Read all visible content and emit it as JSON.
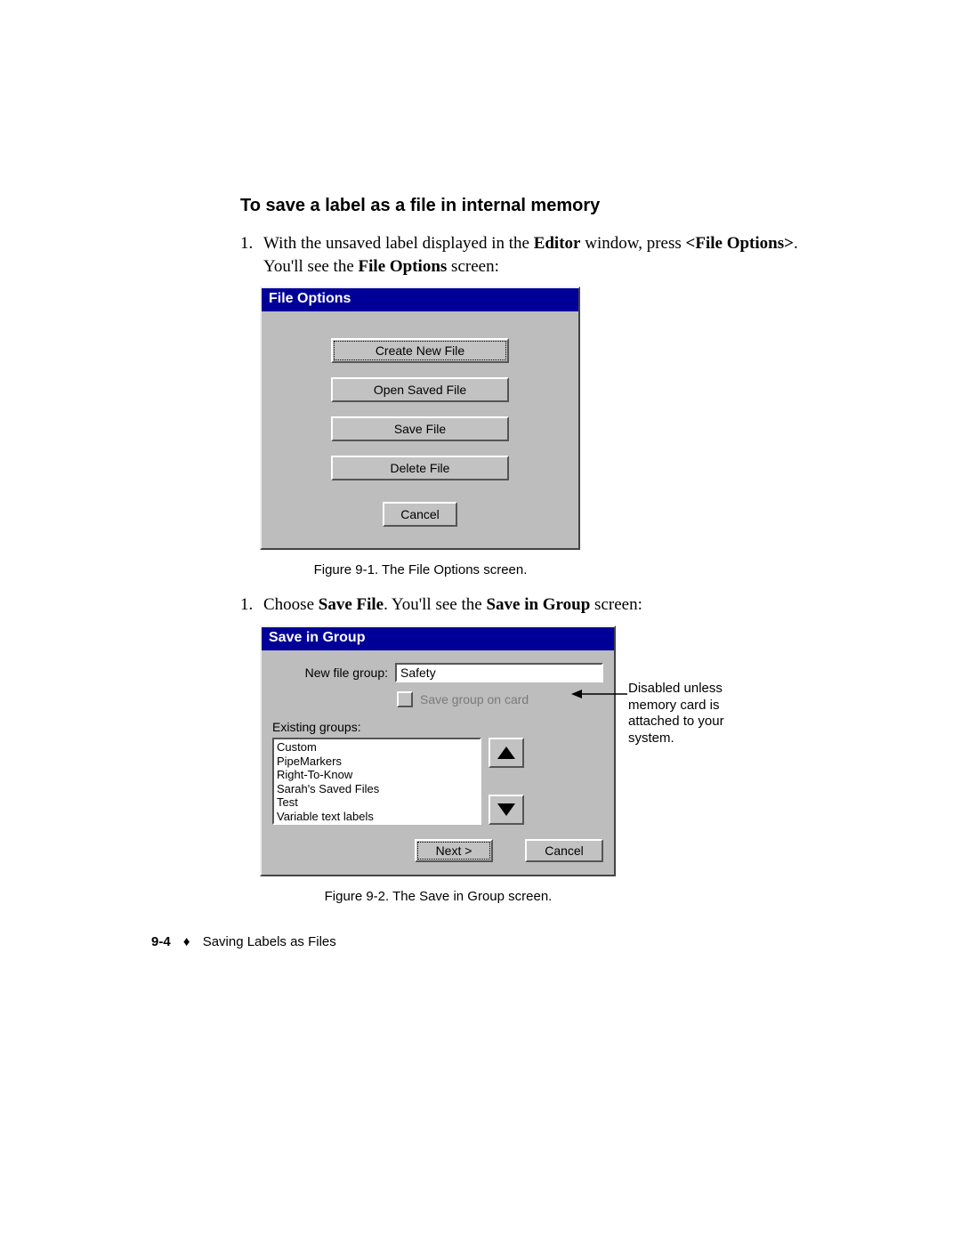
{
  "heading": "To save a label as a file in internal memory",
  "step1": {
    "num": "1.",
    "pre": "With the unsaved label displayed in the ",
    "b1": "Editor",
    "mid1": " window, press ",
    "b2": "<File Options>",
    "mid2": ". You'll see the ",
    "b3": "File Options",
    "post": " screen:"
  },
  "fileOptions": {
    "title": "File Options",
    "buttons": {
      "create": "Create New File",
      "open": "Open Saved File",
      "save": "Save File",
      "delete": "Delete File",
      "cancel": "Cancel"
    }
  },
  "caption1": "Figure 9-1. The File Options screen.",
  "step2": {
    "num": "1.",
    "pre": "Choose ",
    "b1": "Save File",
    "mid1": ". You'll see the ",
    "b2": "Save in Group",
    "post": " screen:"
  },
  "saveInGroup": {
    "title": "Save in Group",
    "newGroupLabel": "New file group:",
    "newGroupValue": "Safety",
    "saveOnCard": "Save group on card",
    "existingLabel": "Existing groups:",
    "groups": [
      "Custom",
      "PipeMarkers",
      "Right-To-Know",
      "Sarah's Saved Files",
      "Test",
      "Variable text labels"
    ],
    "next": "Next >",
    "cancel": "Cancel"
  },
  "callout": "Disabled unless memory card is attached to your system.",
  "caption2": "Figure 9-2. The Save in Group screen.",
  "footer": {
    "page": "9-4",
    "diamond": "♦",
    "title": "Saving Labels as Files"
  }
}
